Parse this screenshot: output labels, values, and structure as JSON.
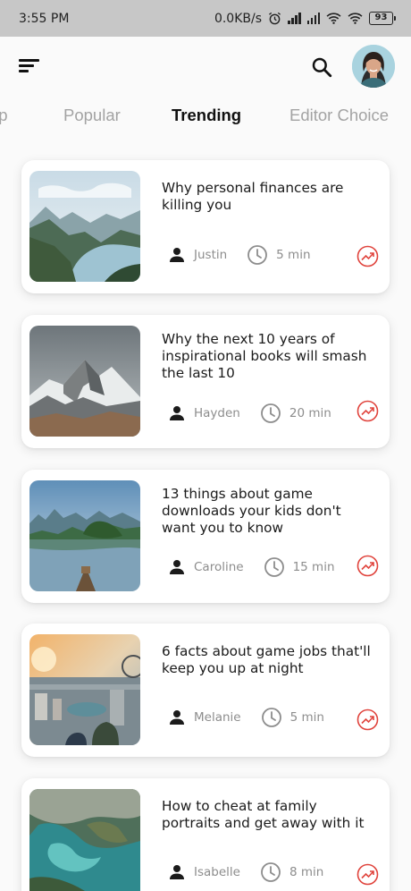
{
  "status_bar": {
    "time": "3:55 PM",
    "network_speed": "0.0KB/s",
    "battery": "93",
    "icons": [
      "alarm-icon",
      "signal-icon",
      "signal-icon",
      "wifi-icon",
      "wifi-icon",
      "battery-icon"
    ]
  },
  "header": {
    "menu_icon": "menu-icon",
    "search_icon": "search-icon",
    "avatar": "user-avatar"
  },
  "tabs": [
    {
      "label": "op",
      "active": false
    },
    {
      "label": "Popular",
      "active": false
    },
    {
      "label": "Trending",
      "active": true
    },
    {
      "label": "Editor Choice",
      "active": false
    }
  ],
  "articles": [
    {
      "title": "Why personal finances are killing you",
      "author": "Justin",
      "duration": "5 min"
    },
    {
      "title": "Why the next 10 years of inspirational books will smash the last 10",
      "author": "Hayden",
      "duration": "20 min"
    },
    {
      "title": "13 things about game downloads your kids don't want you to know",
      "author": "Caroline",
      "duration": "15 min"
    },
    {
      "title": "6 facts about game jobs that'll keep you up at night",
      "author": "Melanie",
      "duration": "5 min"
    },
    {
      "title": "How to cheat at family portraits and get away with it",
      "author": "Isabelle",
      "duration": "8 min"
    }
  ],
  "colors": {
    "accent": "#e0433c",
    "status_bar_bg": "#c7c7c7",
    "page_bg": "#fafafa",
    "muted_text": "#8d8d8d"
  }
}
